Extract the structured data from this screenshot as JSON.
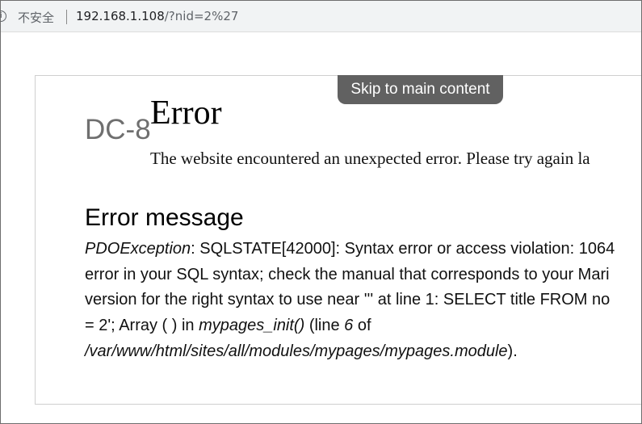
{
  "browser": {
    "insecure_label": "不安全",
    "url_host": "192.168.1.108",
    "url_path": "/?nid=2%27",
    "info_icon": "info-icon"
  },
  "page": {
    "skip_link": "Skip to main content",
    "site_name": "DC-8",
    "error_title": "Error",
    "error_lead": "The website encountered an unexpected error. Please try again la",
    "message_heading": "Error message",
    "message": {
      "exception": "PDOException",
      "line1_rest": ": SQLSTATE[42000]: Syntax error or access violation: 1064",
      "line2": "error in your SQL syntax; check the manual that corresponds to your Mari",
      "line3": "version for the right syntax to use near ''' at line 1: SELECT title FROM no",
      "line4_a": "= 2'; Array ( ) in ",
      "function_name": "mypages_init()",
      "line4_b": " (line ",
      "line_number": "6",
      "line4_c": " of",
      "file_path": "/var/www/html/sites/all/modules/mypages/mypages.module",
      "line5_end": ")."
    }
  }
}
